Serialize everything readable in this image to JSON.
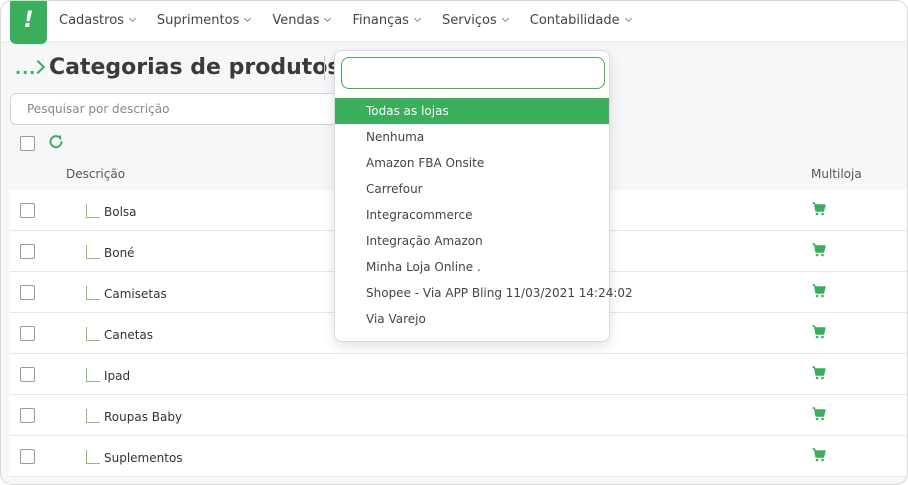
{
  "nav": {
    "logo": "!",
    "items": [
      {
        "label": "Cadastros"
      },
      {
        "label": "Suprimentos"
      },
      {
        "label": "Vendas"
      },
      {
        "label": "Finanças"
      },
      {
        "label": "Serviços"
      },
      {
        "label": "Contabilidade"
      }
    ]
  },
  "header": {
    "breadcrumb": "...",
    "title": "Categorias de produtos"
  },
  "search": {
    "placeholder": "Pesquisar por descrição"
  },
  "table": {
    "columns": {
      "description": "Descrição",
      "multiloja": "Multiloja"
    },
    "rows": [
      {
        "label": "Bolsa"
      },
      {
        "label": "Boné"
      },
      {
        "label": "Camisetas"
      },
      {
        "label": "Canetas"
      },
      {
        "label": "Ipad"
      },
      {
        "label": "Roupas Baby"
      },
      {
        "label": "Suplementos"
      }
    ]
  },
  "store_dropdown": {
    "search_value": "",
    "selected_index": 0,
    "options": [
      {
        "label": "Todas as lojas"
      },
      {
        "label": "Nenhuma"
      },
      {
        "label": "Amazon FBA Onsite"
      },
      {
        "label": "Carrefour"
      },
      {
        "label": "Integracommerce"
      },
      {
        "label": "Integração Amazon"
      },
      {
        "label": "Minha Loja Online ."
      },
      {
        "label": "Shopee - Via APP Bling 11/03/2021 14:24:02"
      },
      {
        "label": "Via Varejo"
      }
    ]
  },
  "colors": {
    "accent": "#3aae5c",
    "tree_line": "#8bbf6a"
  }
}
